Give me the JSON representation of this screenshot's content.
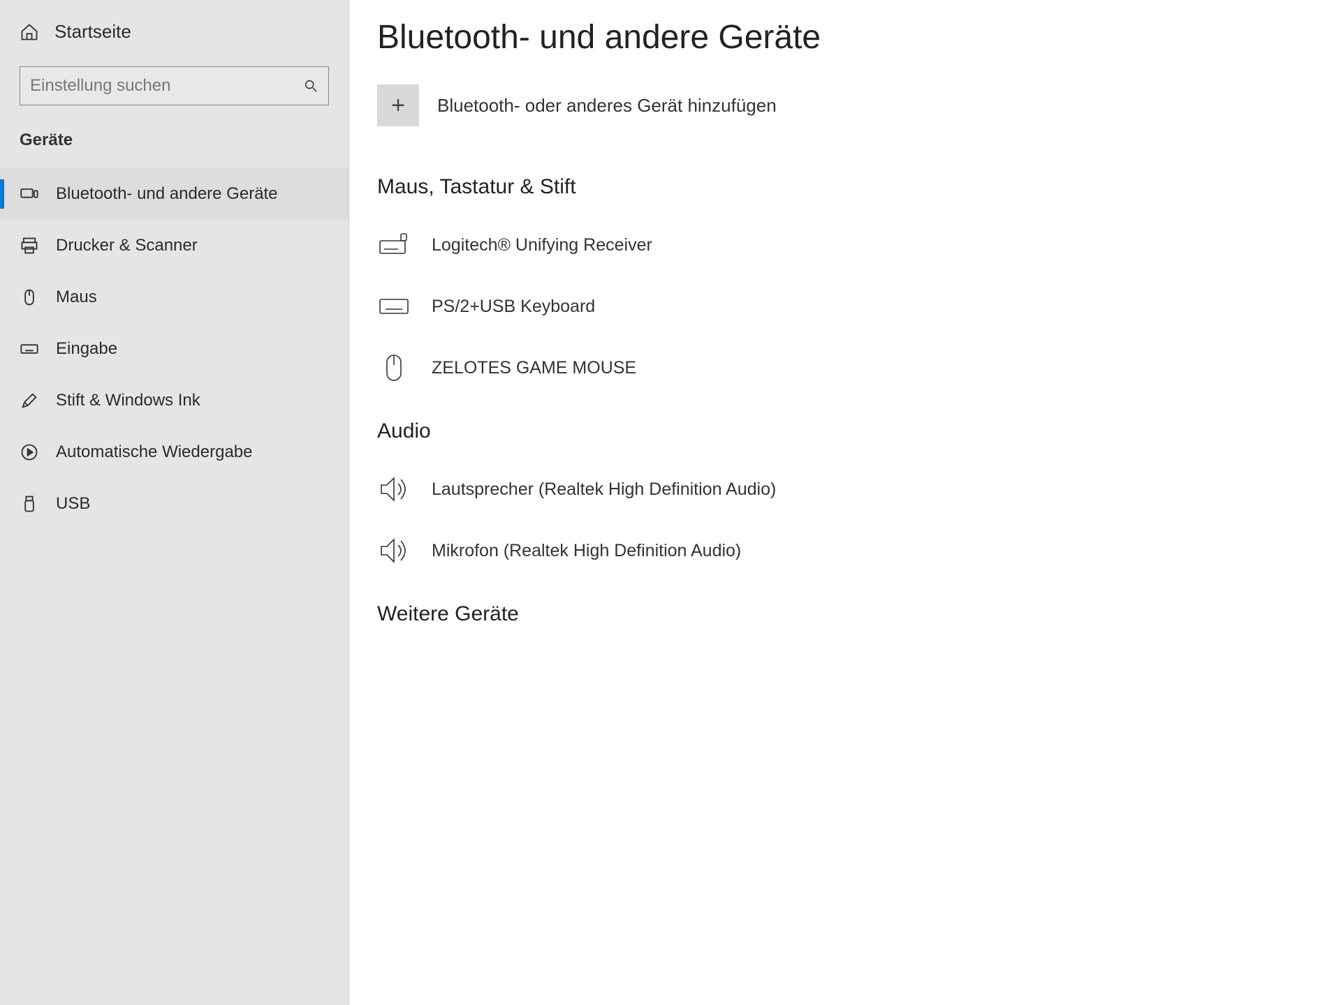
{
  "sidebar": {
    "home_label": "Startseite",
    "search_placeholder": "Einstellung suchen",
    "section_label": "Geräte",
    "items": [
      {
        "label": "Bluetooth- und andere Geräte"
      },
      {
        "label": "Drucker & Scanner"
      },
      {
        "label": "Maus"
      },
      {
        "label": "Eingabe"
      },
      {
        "label": "Stift & Windows Ink"
      },
      {
        "label": "Automatische Wiedergabe"
      },
      {
        "label": "USB"
      }
    ]
  },
  "main": {
    "title": "Bluetooth- und andere Geräte",
    "add_label": "Bluetooth- oder anderes Gerät hinzufügen",
    "sections": {
      "input": {
        "heading": "Maus, Tastatur & Stift",
        "devices": [
          {
            "label": "Logitech® Unifying Receiver"
          },
          {
            "label": "PS/2+USB Keyboard"
          },
          {
            "label": "ZELOTES GAME MOUSE"
          }
        ]
      },
      "audio": {
        "heading": "Audio",
        "devices": [
          {
            "label": "Lautsprecher (Realtek High Definition Audio)"
          },
          {
            "label": "Mikrofon (Realtek High Definition Audio)"
          }
        ]
      },
      "other": {
        "heading": "Weitere Geräte"
      }
    }
  }
}
